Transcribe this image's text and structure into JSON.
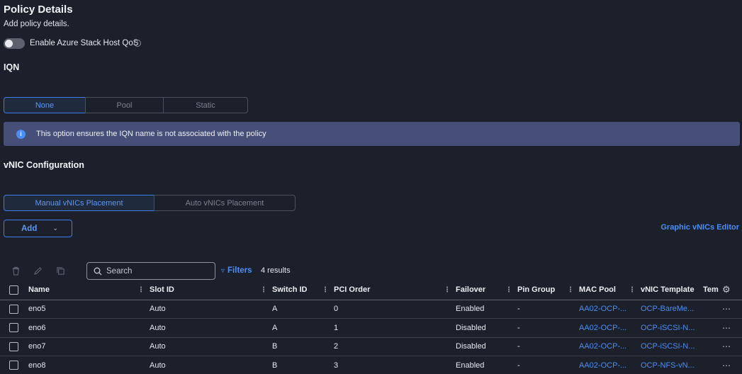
{
  "header": {
    "title": "Policy Details",
    "subtitle": "Add policy details."
  },
  "qos_toggle": {
    "label": "Enable Azure Stack Host QoS",
    "on": false,
    "info_icon": "info-circle-icon"
  },
  "iqn": {
    "title": "IQN",
    "options": [
      "None",
      "Pool",
      "Static"
    ],
    "selected": "None",
    "banner": "This option ensures the IQN name is not associated with the policy"
  },
  "vnic": {
    "title": "vNIC Configuration",
    "placement_options": [
      "Manual vNICs Placement",
      "Auto vNICs Placement"
    ],
    "selected": "Manual vNICs Placement",
    "add_label": "Add",
    "graphic_editor_label": "Graphic vNICs Editor"
  },
  "toolbar": {
    "search_placeholder": "Search",
    "filters_label": "Filters",
    "results_text": "4 results"
  },
  "table": {
    "columns": [
      "Name",
      "Slot ID",
      "Switch ID",
      "PCI Order",
      "Failover",
      "Pin Group",
      "MAC Pool",
      "vNIC Template",
      "Tem"
    ],
    "rows": [
      {
        "name": "eno5",
        "slot": "Auto",
        "switch": "A",
        "pci": "0",
        "failover": "Enabled",
        "pin": "-",
        "mac": "AA02-OCP-...",
        "template": "OCP-BareMe..."
      },
      {
        "name": "eno6",
        "slot": "Auto",
        "switch": "A",
        "pci": "1",
        "failover": "Disabled",
        "pin": "-",
        "mac": "AA02-OCP-...",
        "template": "OCP-iSCSI-N..."
      },
      {
        "name": "eno7",
        "slot": "Auto",
        "switch": "B",
        "pci": "2",
        "failover": "Disabled",
        "pin": "-",
        "mac": "AA02-OCP-...",
        "template": "OCP-iSCSI-N..."
      },
      {
        "name": "eno8",
        "slot": "Auto",
        "switch": "B",
        "pci": "3",
        "failover": "Enabled",
        "pin": "-",
        "mac": "AA02-OCP-...",
        "template": "OCP-NFS-vN..."
      }
    ]
  },
  "colors": {
    "background": "#1c202a",
    "accent": "#3d7ff0",
    "link": "#4d8ef5",
    "banner": "#454f78"
  }
}
